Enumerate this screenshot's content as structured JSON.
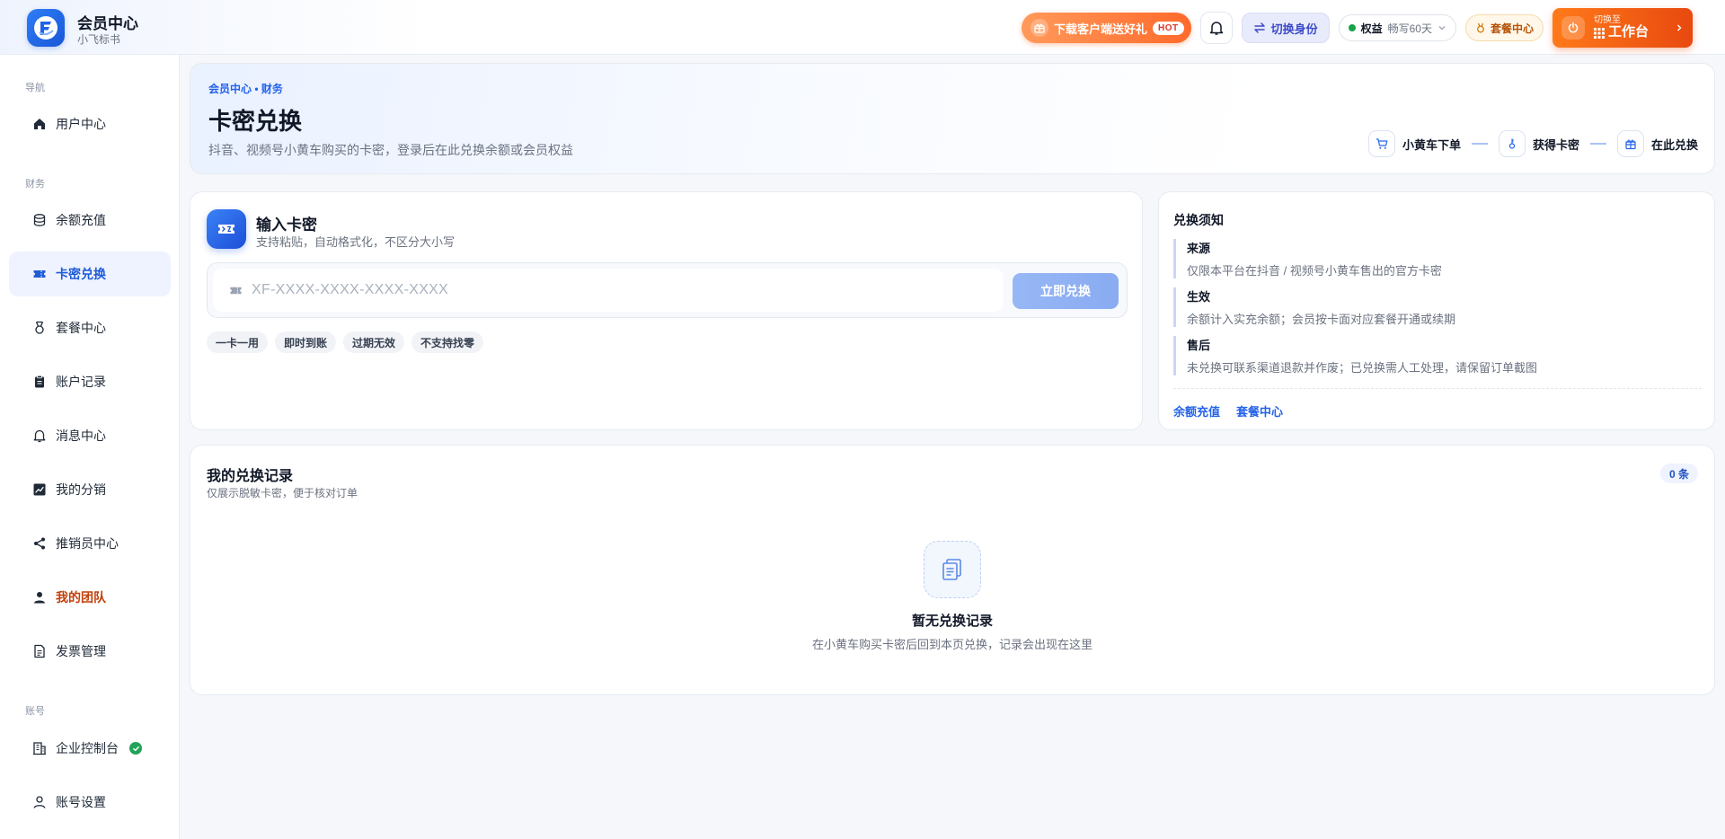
{
  "brand": {
    "title": "会员中心",
    "subtitle": "小飞标书"
  },
  "header": {
    "download_label": "下载客户端送好礼",
    "hot_badge": "HOT",
    "switch_identity": "切换身份",
    "rights_label": "权益",
    "rights_value": "畅写60天",
    "package_label": "套餐中心",
    "workbench_small": "切换至",
    "workbench_big": "工作台"
  },
  "sidebar": {
    "groups": {
      "nav": "导航",
      "finance": "财务",
      "account": "账号"
    },
    "items": [
      {
        "label": "用户中心",
        "icon": "home-icon"
      },
      {
        "label": "余额充值",
        "icon": "database-icon"
      },
      {
        "label": "卡密兑换",
        "icon": "ticket-icon",
        "active": true
      },
      {
        "label": "套餐中心",
        "icon": "medal-icon"
      },
      {
        "label": "账户记录",
        "icon": "clipboard-icon"
      },
      {
        "label": "消息中心",
        "icon": "bell-icon"
      },
      {
        "label": "我的分销",
        "icon": "chart-icon"
      },
      {
        "label": "推销员中心",
        "icon": "share-icon"
      },
      {
        "label": "我的团队",
        "icon": "user-icon"
      },
      {
        "label": "发票管理",
        "icon": "file-icon"
      },
      {
        "label": "企业控制台",
        "icon": "building-icon"
      },
      {
        "label": "账号设置",
        "icon": "user-outline-icon"
      }
    ]
  },
  "hero": {
    "breadcrumb": "会员中心 • 财务",
    "title": "卡密兑换",
    "description": "抖音、视频号小黄车购买的卡密，登录后在此兑换余额或会员权益",
    "steps": [
      "小黄车下单",
      "获得卡密",
      "在此兑换"
    ]
  },
  "redeem": {
    "title": "输入卡密",
    "subtitle": "支持粘贴，自动格式化，不区分大小写",
    "input_value": "",
    "input_placeholder": "XF-XXXX-XXXX-XXXX-XXXX",
    "button_label": "立即兑换",
    "tags": [
      "一卡一用",
      "即时到账",
      "过期无效",
      "不支持找零"
    ]
  },
  "notice": {
    "title": "兑换须知",
    "items": [
      {
        "title": "来源",
        "desc": "仅限本平台在抖音 / 视频号小黄车售出的官方卡密"
      },
      {
        "title": "生效",
        "desc": "余额计入实充余额；会员按卡面对应套餐开通或续期"
      },
      {
        "title": "售后",
        "desc": "未兑换可联系渠道退款并作废；已兑换需人工处理，请保留订单截图"
      }
    ],
    "links": [
      "余额充值",
      "套餐中心"
    ]
  },
  "records": {
    "title": "我的兑换记录",
    "subtitle": "仅展示脱敏卡密，便于核对订单",
    "count": "0 条",
    "empty_title": "暂无兑换记录",
    "empty_desc": "在小黄车购买卡密后回到本页兑换，记录会出现在这里"
  },
  "colors": {
    "primary": "#2563eb",
    "accent_orange": "#ff6a2b",
    "active_bg": "#eef3ff",
    "team_text": "#c2410c",
    "success": "#22a35a"
  }
}
